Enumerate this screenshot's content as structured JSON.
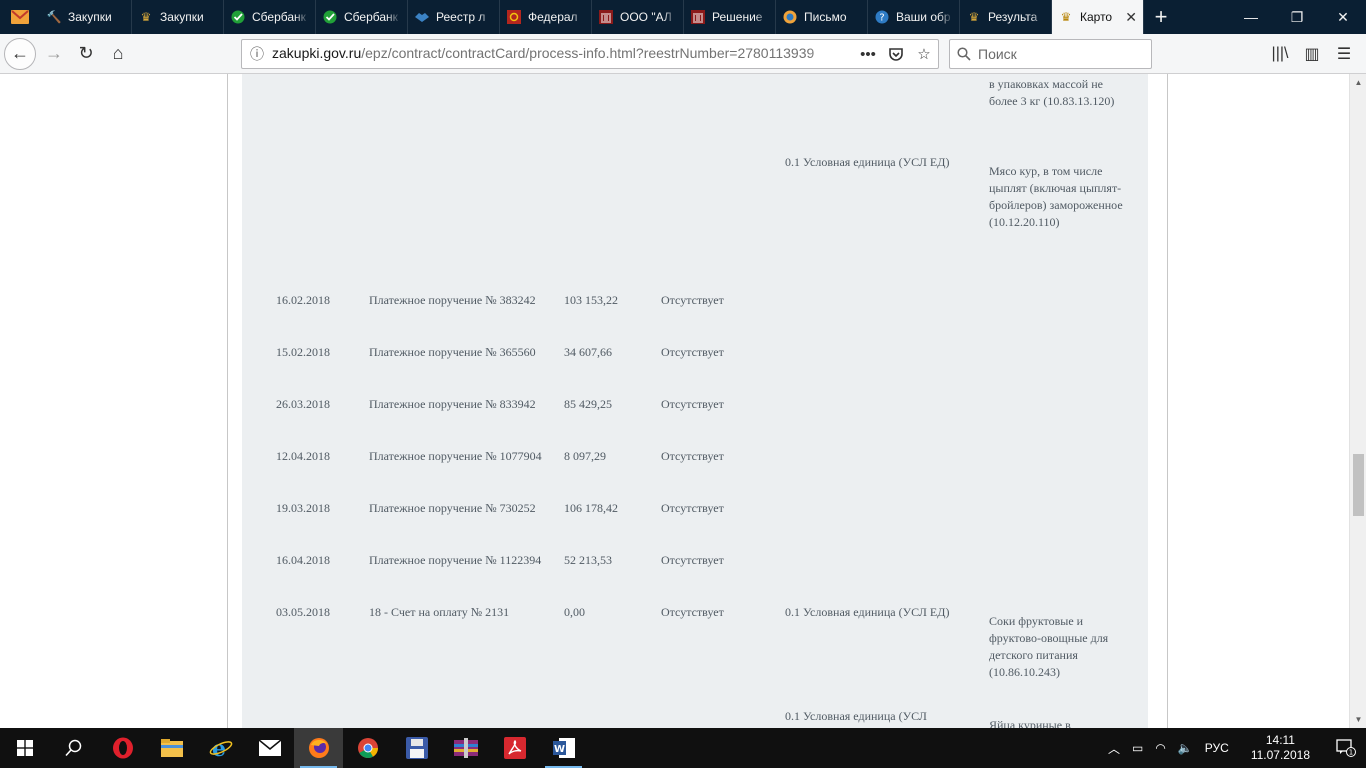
{
  "browser": {
    "tabs": [
      {
        "label": "",
        "icon": "envelope-icon",
        "color": "#e8a33c"
      },
      {
        "label": "Закупки",
        "icon": "hammer-icon"
      },
      {
        "label": "Закупки",
        "icon": "emblem-icon"
      },
      {
        "label": "Сбербанк",
        "icon": "sberbank-icon"
      },
      {
        "label": "Сбербанк",
        "icon": "sberbank-icon"
      },
      {
        "label": "Реестр л",
        "icon": "handshake-icon"
      },
      {
        "label": "Федерал",
        "icon": "fas-icon"
      },
      {
        "label": "ООО \"АЛ",
        "icon": "building-icon"
      },
      {
        "label": "Решение",
        "icon": "building-icon"
      },
      {
        "label": "Письмо",
        "icon": "mail-icon"
      },
      {
        "label": "Ваши обр",
        "icon": "help-icon"
      },
      {
        "label": "Результа",
        "icon": "emblem-icon"
      },
      {
        "label": "Карто",
        "icon": "emblem-icon",
        "active": true
      }
    ],
    "url_host": "zakupki.gov.ru",
    "url_path": "/epz/contract/contractCard/process-info.html?reestrNumber=2780113939",
    "search_placeholder": "Поиск"
  },
  "rows": [
    {
      "product": "в упаковках массой не более 3 кг (10.83.13.120)"
    },
    {
      "unit": "0.1 Условная единица (УСЛ ЕД)",
      "product": "Мясо кур, в том числе цыплят (включая цыплят-бройлеров) замороженное (10.12.20.110)"
    },
    {
      "date": "16.02.2018",
      "doc": "Платежное поручение № 383242",
      "sum": "103 153,22",
      "status": "Отсутствует"
    },
    {
      "date": "15.02.2018",
      "doc": "Платежное поручение № 365560",
      "sum": "34 607,66",
      "status": "Отсутствует"
    },
    {
      "date": "26.03.2018",
      "doc": "Платежное поручение № 833942",
      "sum": "85 429,25",
      "status": "Отсутствует"
    },
    {
      "date": "12.04.2018",
      "doc": "Платежное поручение № 1077904",
      "sum": "8 097,29",
      "status": "Отсутствует"
    },
    {
      "date": "19.03.2018",
      "doc": "Платежное поручение № 730252",
      "sum": "106 178,42",
      "status": "Отсутствует"
    },
    {
      "date": "16.04.2018",
      "doc": "Платежное поручение № 1122394",
      "sum": "52 213,53",
      "status": "Отсутствует"
    },
    {
      "date": "03.05.2018",
      "doc": "18 - Счет на оплату № 2131",
      "sum": "0,00",
      "status": "Отсутствует",
      "unit": "0.1 Условная единица (УСЛ ЕД)",
      "product": "Соки фруктовые и фруктово-овощные для детского питания (10.86.10.243)"
    },
    {
      "unit": "0.1 Условная единица (УСЛ",
      "product": "Яйца куриные в"
    }
  ],
  "taskbar": {
    "language": "РУС",
    "time": "14:11",
    "date": "11.07.2018",
    "notifications": "1"
  },
  "colors": {
    "tabstrip": "#0a1f33",
    "panel": "#eceff1",
    "text": "#505a63"
  }
}
